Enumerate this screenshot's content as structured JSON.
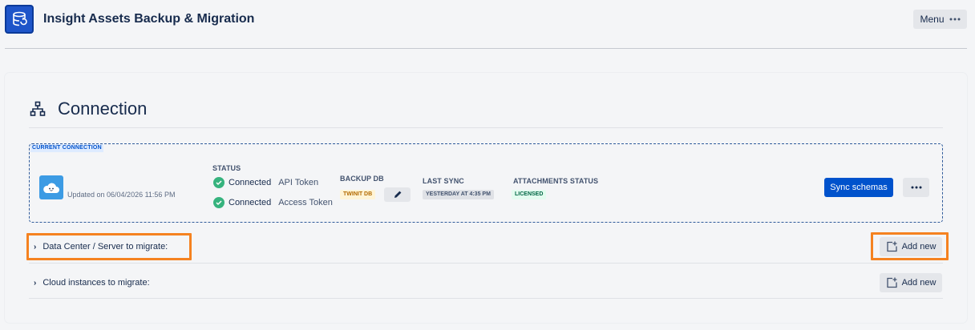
{
  "app": {
    "title": "Insight Assets Backup & Migration",
    "menu_label": "Menu",
    "menu_icon": "more-horizontal-icon"
  },
  "section": {
    "title": "Connection",
    "icon": "hierarchy-icon"
  },
  "current_connection": {
    "tag": "CURRENT CONNECTION",
    "avatar_icon": "cloud-face-icon",
    "updated": "Updated on 06/04/2026 11:56 PM",
    "status": {
      "label": "STATUS",
      "items": [
        {
          "state": "Connected",
          "type": "API Token"
        },
        {
          "state": "Connected",
          "type": "Access Token"
        }
      ]
    },
    "backup_db": {
      "label": "BACKUP DB",
      "value": "TWINIT DB",
      "edit_icon": "pencil-icon"
    },
    "last_sync": {
      "label": "LAST SYNC",
      "value": "YESTERDAY AT 4:35 PM"
    },
    "attachments": {
      "label": "ATTACHMENTS STATUS",
      "value": "LICENSED"
    },
    "sync_button": "Sync schemas",
    "more_icon": "more-horizontal-icon"
  },
  "migrate_rows": [
    {
      "label": "Data Center / Server to migrate:",
      "add_label": "Add new"
    },
    {
      "label": "Cloud instances to migrate:",
      "add_label": "Add new"
    }
  ],
  "colors": {
    "primary": "#0052cc",
    "success": "#36b37e",
    "highlight": "#f58220",
    "text": "#172b4d"
  }
}
